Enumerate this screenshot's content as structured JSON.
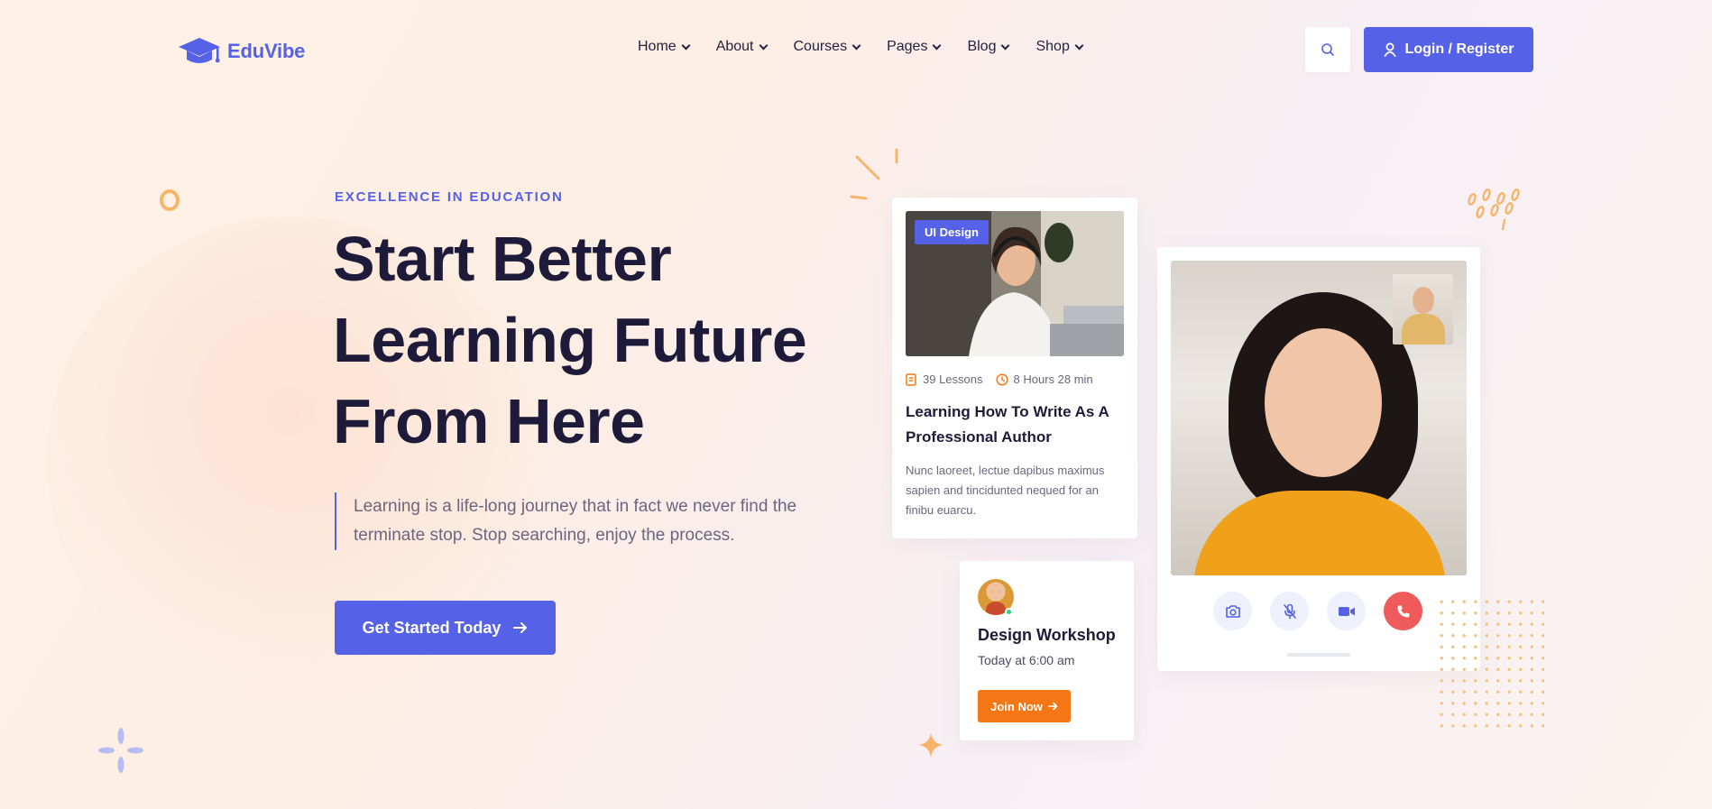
{
  "brand": {
    "name": "EduVibe",
    "accent": "#5561e6",
    "orange": "#f57614"
  },
  "nav": {
    "items": [
      {
        "label": "Home"
      },
      {
        "label": "About"
      },
      {
        "label": "Courses"
      },
      {
        "label": "Pages"
      },
      {
        "label": "Blog"
      },
      {
        "label": "Shop"
      }
    ],
    "search_icon": "search-icon",
    "login_label": "Login / Register"
  },
  "hero": {
    "eyebrow": "EXCELLENCE IN EDUCATION",
    "title_line1": "Start Better",
    "title_line2": "Learning Future",
    "title_line3": "From Here",
    "description": "Learning is a life-long journey that in fact we never find the terminate stop. Stop searching, enjoy the process.",
    "cta_label": "Get Started Today"
  },
  "course_card": {
    "tag": "UI Design",
    "lessons": "39 Lessons",
    "duration": "8 Hours 28 min",
    "title": "Learning How To Write As A Professional Author",
    "text": "Nunc laoreet, lectue dapibus maximus sapien and tincidunted nequed for an finibu euarcu."
  },
  "workshop_card": {
    "title": "Design Workshop",
    "time": "Today at 6:00 am",
    "join_label": "Join Now"
  },
  "video_card": {
    "controls": [
      "camera-icon",
      "mic-off-icon",
      "video-icon",
      "phone-end-icon"
    ],
    "end_call_color": "#ef5a5a"
  }
}
